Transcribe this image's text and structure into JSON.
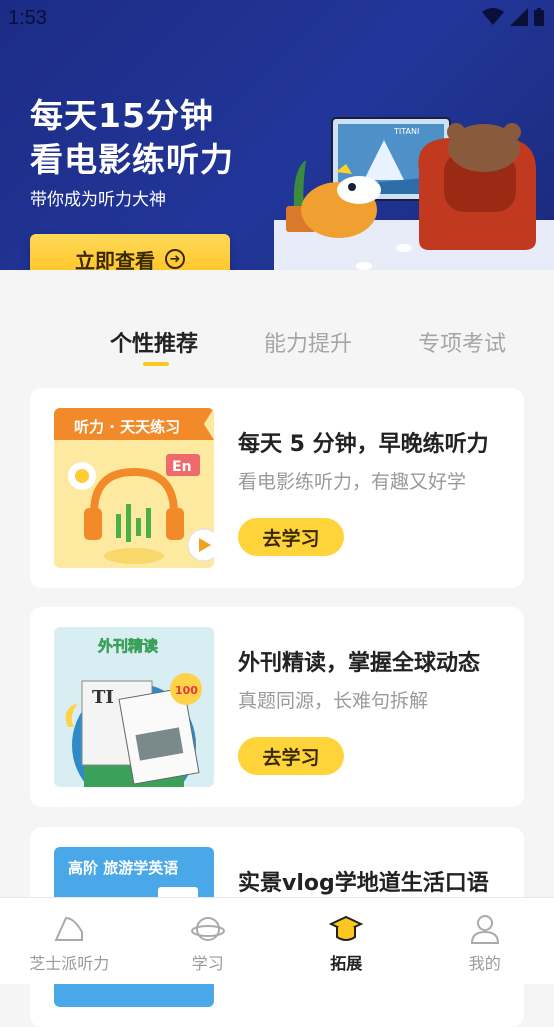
{
  "status": {
    "time": "1:53"
  },
  "banner": {
    "title_line1": "每天15分钟",
    "title_line2": "看电影练听力",
    "subtitle": "带你成为听力大神",
    "cta_label": "立即查看",
    "tv_label": "TITANI"
  },
  "tabs": [
    {
      "label": "个性推荐",
      "active": true
    },
    {
      "label": "能力提升",
      "active": false
    },
    {
      "label": "专项考试",
      "active": false
    }
  ],
  "cards": [
    {
      "image_tag": "听力 · 天天练习",
      "badge": "En",
      "title": "每天 5 分钟，早晚练听力",
      "subtitle": "看电影练听力，有趣又好学",
      "button": "去学习"
    },
    {
      "image_tag": "外刊精读",
      "badge": "100",
      "title": "外刊精读，掌握全球动态",
      "subtitle": "真题同源，长难句拆解",
      "button": "去学习"
    },
    {
      "image_tag": "高阶 旅游学英语",
      "title": "实景vlog学地道生活口语"
    }
  ],
  "nav": [
    {
      "label": "芝士派听力",
      "icon": "cheese-icon",
      "active": false
    },
    {
      "label": "学习",
      "icon": "planet-icon",
      "active": false
    },
    {
      "label": "拓展",
      "icon": "graduation-cap-icon",
      "active": true
    },
    {
      "label": "我的",
      "icon": "user-icon",
      "active": false
    }
  ],
  "colors": {
    "accent": "#ffc61f",
    "banner": "#22369a"
  }
}
